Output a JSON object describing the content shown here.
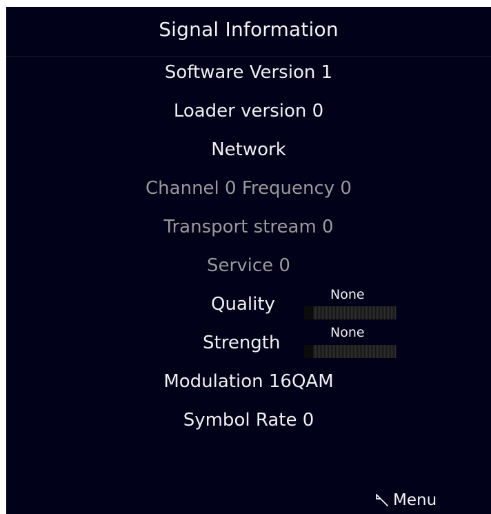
{
  "header": {
    "title": "Signal Information"
  },
  "info": {
    "software_version": "Software Version 1",
    "loader_version": "Loader version 0",
    "network": "Network",
    "channel_frequency": "Channel 0 Frequency 0",
    "transport_stream": "Transport stream 0",
    "service": "Service 0",
    "modulation": "Modulation 16QAM",
    "symbol_rate": "Symbol Rate 0"
  },
  "quality": {
    "label": "Quality",
    "value": "None",
    "level_percent": 0
  },
  "strength": {
    "label": "Strength",
    "value": "None",
    "level_percent": 0
  },
  "footer": {
    "back_icon": "back-arrow-icon",
    "menu_label": "Menu"
  },
  "colors": {
    "background": "#01011a",
    "text": "#f0f0f0",
    "dim_text": "#9a9a9a"
  }
}
